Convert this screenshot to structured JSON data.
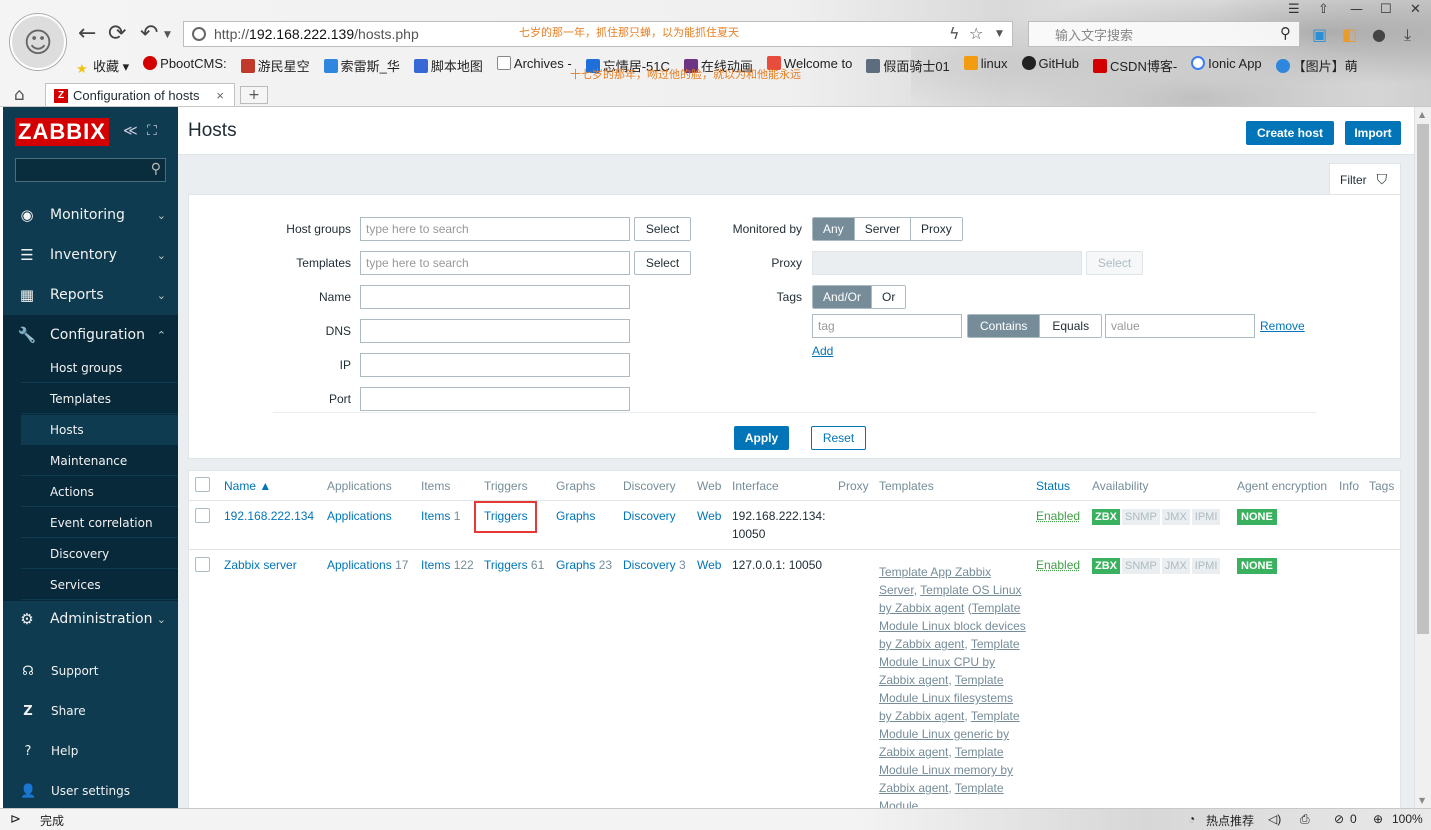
{
  "browser": {
    "url_prefix": "http://",
    "url_host": "192.168.222.139",
    "url_path": "/hosts.php",
    "search_placeholder": "输入文字搜索",
    "marquee_top": "七岁的那一年，抓住那只蝉，以为能抓住夏天",
    "marquee_bottom": "十七岁的那年，吻过他的脸，就以为和他能永远",
    "bookmarks": [
      "收藏",
      "PbootCMS:",
      "游民星空",
      "索雷斯_华",
      "脚本地图",
      "Archives -",
      "忘情居-51C",
      "在线动画",
      "Welcome to",
      "假面骑士01",
      "linux",
      "GitHub",
      "CSDN博客-",
      "Ionic App",
      "【图片】萌"
    ],
    "tab_title": "Configuration of hosts",
    "tab_close": "×",
    "new_tab": "+",
    "status_left": "完成",
    "status_hot": "热点推荐",
    "status_count": "0",
    "zoom": "100%"
  },
  "sidebar": {
    "logo": "ZABBIX",
    "menu": [
      {
        "label": "Monitoring"
      },
      {
        "label": "Inventory"
      },
      {
        "label": "Reports"
      },
      {
        "label": "Configuration"
      }
    ],
    "submenu": [
      "Host groups",
      "Templates",
      "Hosts",
      "Maintenance",
      "Actions",
      "Event correlation",
      "Discovery",
      "Services"
    ],
    "admin": "Administration",
    "bottom": [
      "Support",
      "Share",
      "Help",
      "User settings"
    ]
  },
  "header": {
    "title": "Hosts",
    "create_host": "Create host",
    "import": "Import"
  },
  "filter": {
    "tab_label": "Filter",
    "host_groups_label": "Host groups",
    "templates_label": "Templates",
    "name_label": "Name",
    "dns_label": "DNS",
    "ip_label": "IP",
    "port_label": "Port",
    "search_placeholder": "type here to search",
    "select": "Select",
    "monitored_by_label": "Monitored by",
    "monitored_by_options": [
      "Any",
      "Server",
      "Proxy"
    ],
    "proxy_label": "Proxy",
    "tags_label": "Tags",
    "tags_mode": [
      "And/Or",
      "Or"
    ],
    "tag_placeholder": "tag",
    "tag_ops": [
      "Contains",
      "Equals"
    ],
    "value_placeholder": "value",
    "remove": "Remove",
    "add": "Add",
    "apply": "Apply",
    "reset": "Reset"
  },
  "table": {
    "headers": {
      "name": "Name ▲",
      "applications": "Applications",
      "items": "Items",
      "triggers": "Triggers",
      "graphs": "Graphs",
      "discovery": "Discovery",
      "web": "Web",
      "interface": "Interface",
      "proxy": "Proxy",
      "templates": "Templates",
      "status": "Status",
      "availability": "Availability",
      "agent_encryption": "Agent encryption",
      "info": "Info",
      "tags": "Tags"
    },
    "rows": [
      {
        "name": "192.168.222.134",
        "applications": "Applications",
        "applications_count": "",
        "items": "Items",
        "items_count": "1",
        "triggers": "Triggers",
        "triggers_count": "",
        "graphs": "Graphs",
        "graphs_count": "",
        "discovery": "Discovery",
        "discovery_count": "",
        "web": "Web",
        "interface_1": "192.168.222.134:",
        "interface_2": "10050",
        "status": "Enabled",
        "encryption": "NONE"
      },
      {
        "name": "Zabbix server",
        "applications": "Applications",
        "applications_count": "17",
        "items": "Items",
        "items_count": "122",
        "triggers": "Triggers",
        "triggers_count": "61",
        "graphs": "Graphs",
        "graphs_count": "23",
        "discovery": "Discovery",
        "discovery_count": "3",
        "web": "Web",
        "interface_1": "127.0.0.1: 10050",
        "interface_2": "",
        "status": "Enabled",
        "encryption": "NONE",
        "templates": [
          {
            "text": "Template App Zabbix Server",
            "sep": ", "
          },
          {
            "text": "Template OS Linux by Zabbix agent",
            "sep": " ("
          },
          {
            "text": "Template Module Linux block devices by Zabbix agent",
            "sep": ", "
          },
          {
            "text": "Template Module Linux CPU by Zabbix agent",
            "sep": ", "
          },
          {
            "text": "Template Module Linux filesystems by Zabbix agent",
            "sep": ", "
          },
          {
            "text": "Template Module Linux generic by Zabbix agent",
            "sep": ", "
          },
          {
            "text": "Template Module Linux memory by Zabbix agent",
            "sep": ", "
          },
          {
            "text": "Template Module",
            "sep": ""
          }
        ]
      }
    ],
    "availability": [
      "ZBX",
      "SNMP",
      "JMX",
      "IPMI"
    ]
  },
  "colors": {
    "brand_red": "#d40000",
    "sidebar": "#0e3b50",
    "link": "#0275b8",
    "ok_green": "#3ab15e",
    "highlight": "#e53935"
  }
}
